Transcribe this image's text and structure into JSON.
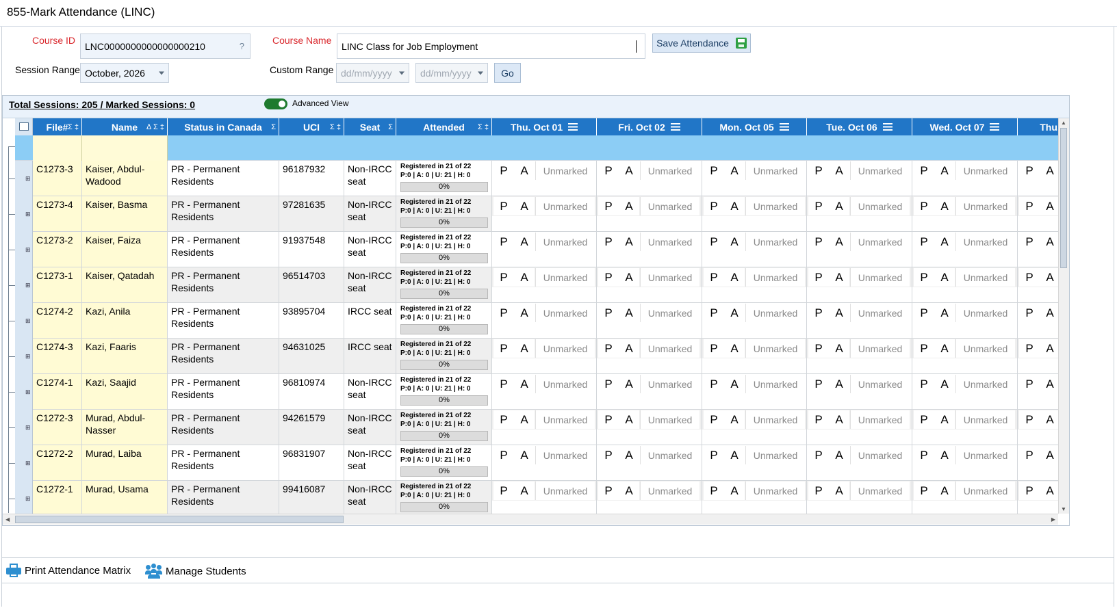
{
  "window": {
    "title": "855-Mark Attendance (LINC)"
  },
  "form": {
    "course_id_label": "Course ID",
    "course_id_value": "LNC0000000000000000210",
    "course_id_help": "?",
    "course_name_label": "Course Name",
    "course_name_value": "LINC Class for Job Employment",
    "save_label": "Save Attendance",
    "session_range_label": "Session Range",
    "session_range_value": "October, 2026",
    "custom_range_label": "Custom Range",
    "date_from_placeholder": "dd/mm/yyyy",
    "date_to_placeholder": "dd/mm/yyyy",
    "go_label": "Go"
  },
  "summary": {
    "text": "Total Sessions: 205 / Marked Sessions: 0",
    "advanced_view_label": "Advanced View",
    "advanced_view_on": true
  },
  "columns": {
    "file": "File#",
    "name": "Name",
    "status": "Status in Canada",
    "uci": "UCI",
    "seat": "Seat",
    "attended": "Attended",
    "sigma": "Σ",
    "sigma_pin": "Σ ‡",
    "name_sort": "∆ Σ ‡",
    "days": [
      "Thu. Oct 01",
      "Fri. Oct 02",
      "Mon. Oct 05",
      "Tue. Oct 06",
      "Wed. Oct 07",
      "Thu."
    ]
  },
  "cell_labels": {
    "present": "P",
    "absent": "A",
    "unmarked": "Unmarked"
  },
  "rows": [
    {
      "file": "C1273-3",
      "name": "Kaiser, Abdul-Wadood",
      "status": "PR - Permanent Residents",
      "uci": "96187932",
      "seat": "Non-IRCC seat",
      "att_line1": "Registered in 21 of 22",
      "att_line2": "P:0 | A: 0 | U: 21 | H: 0",
      "pct": "0%"
    },
    {
      "file": "C1273-4",
      "name": "Kaiser, Basma",
      "status": "PR - Permanent Residents",
      "uci": "97281635",
      "seat": "Non-IRCC seat",
      "att_line1": "Registered in 21 of 22",
      "att_line2": "P:0 | A: 0 | U: 21 | H: 0",
      "pct": "0%"
    },
    {
      "file": "C1273-2",
      "name": "Kaiser, Faiza",
      "status": "PR - Permanent Residents",
      "uci": "91937548",
      "seat": "Non-IRCC seat",
      "att_line1": "Registered in 21 of 22",
      "att_line2": "P:0 | A: 0 | U: 21 | H: 0",
      "pct": "0%"
    },
    {
      "file": "C1273-1",
      "name": "Kaiser, Qatadah",
      "status": "PR - Permanent Residents",
      "uci": "96514703",
      "seat": "Non-IRCC seat",
      "att_line1": "Registered in 21 of 22",
      "att_line2": "P:0 | A: 0 | U: 21 | H: 0",
      "pct": "0%"
    },
    {
      "file": "C1274-2",
      "name": "Kazi, Anila",
      "status": "PR - Permanent Residents",
      "uci": "93895704",
      "seat": "IRCC seat",
      "att_line1": "Registered in 21 of 22",
      "att_line2": "P:0 | A: 0 | U: 21 | H: 0",
      "pct": "0%"
    },
    {
      "file": "C1274-3",
      "name": "Kazi, Faaris",
      "status": "PR - Permanent Residents",
      "uci": "94631025",
      "seat": "IRCC seat",
      "att_line1": "Registered in 21 of 22",
      "att_line2": "P:0 | A: 0 | U: 21 | H: 0",
      "pct": "0%"
    },
    {
      "file": "C1274-1",
      "name": "Kazi, Saajid",
      "status": "PR - Permanent Residents",
      "uci": "96810974",
      "seat": "Non-IRCC seat",
      "att_line1": "Registered in 21 of 22",
      "att_line2": "P:0 | A: 0 | U: 21 | H: 0",
      "pct": "0%"
    },
    {
      "file": "C1272-3",
      "name": "Murad, Abdul-Nasser",
      "status": "PR - Permanent Residents",
      "uci": "94261579",
      "seat": "Non-IRCC seat",
      "att_line1": "Registered in 21 of 22",
      "att_line2": "P:0 | A: 0 | U: 21 | H: 0",
      "pct": "0%"
    },
    {
      "file": "C1272-2",
      "name": "Murad, Laiba",
      "status": "PR - Permanent Residents",
      "uci": "96831907",
      "seat": "Non-IRCC seat",
      "att_line1": "Registered in 21 of 22",
      "att_line2": "P:0 | A: 0 | U: 21 | H: 0",
      "pct": "0%"
    },
    {
      "file": "C1272-1",
      "name": "Murad, Usama",
      "status": "PR - Permanent Residents",
      "uci": "99416087",
      "seat": "Non-IRCC seat",
      "att_line1": "Registered in 21 of 22",
      "att_line2": "P:0 | A: 0 | U: 21 | H: 0",
      "pct": "0%"
    }
  ],
  "footer": {
    "print_label": "Print Attendance Matrix",
    "manage_label": "Manage Students"
  },
  "colors": {
    "header_blue": "#2176c7",
    "filter_row": "#8ccdf5",
    "frozen_yellow": "#fffbd4",
    "required_red": "#d9262b",
    "toggle_green": "#1e7a2e"
  }
}
